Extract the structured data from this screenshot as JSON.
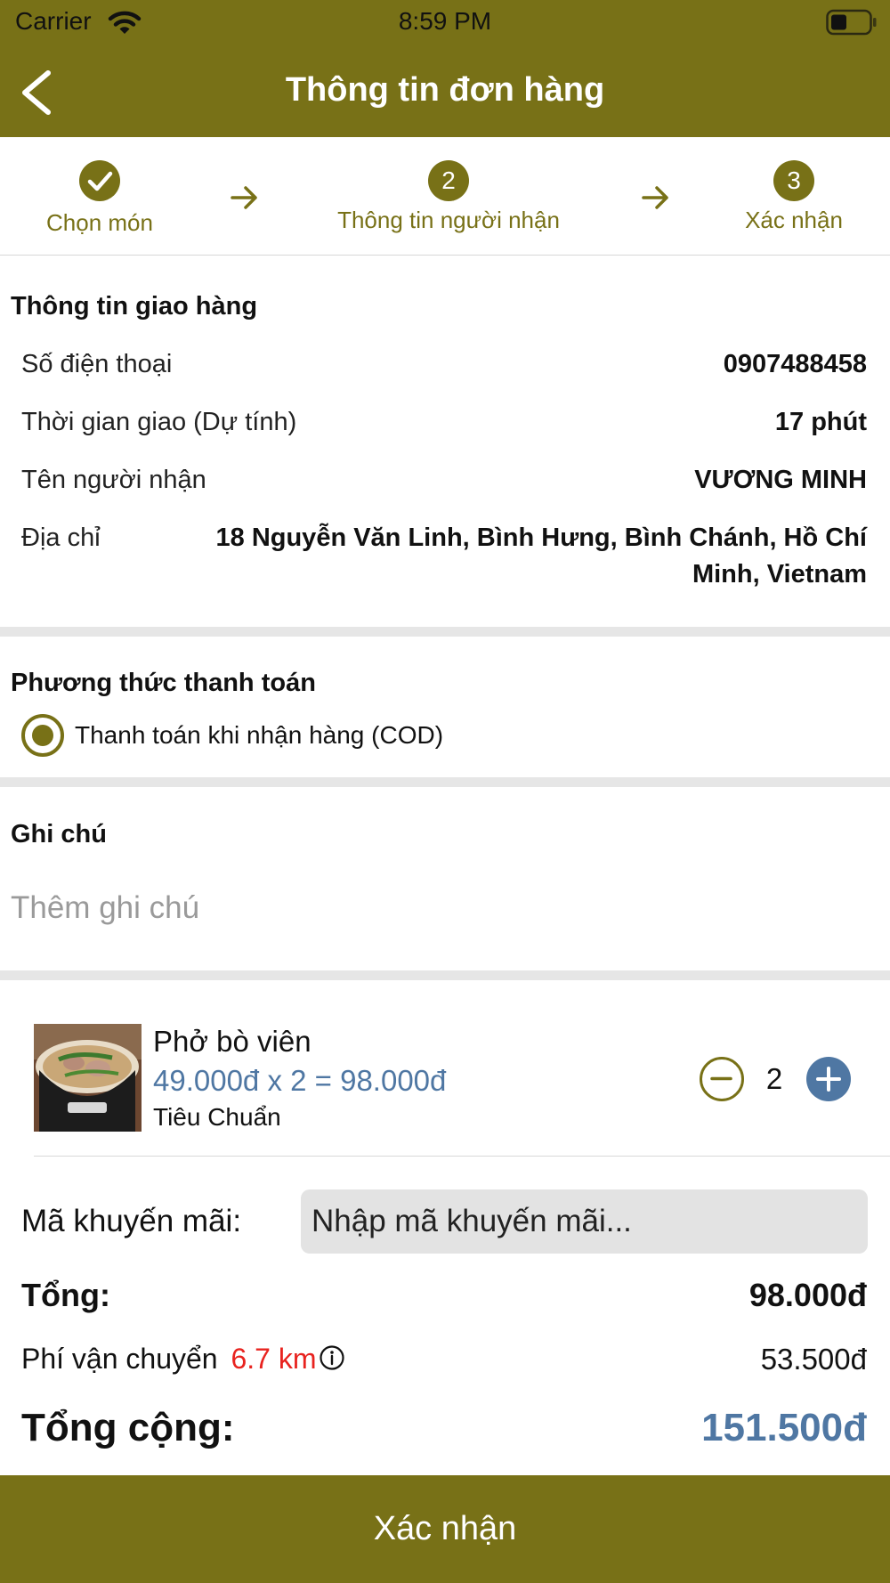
{
  "status_bar": {
    "carrier": "Carrier",
    "time": "8:59 PM"
  },
  "header": {
    "title": "Thông tin đơn hàng",
    "back_icon": "chevron-left-icon"
  },
  "steps": [
    {
      "label": "Chọn món",
      "marker": "✓",
      "done": true
    },
    {
      "label": "Thông tin người nhận",
      "marker": "2",
      "done": false
    },
    {
      "label": "Xác nhận",
      "marker": "3",
      "done": false
    }
  ],
  "delivery": {
    "title": "Thông tin giao hàng",
    "phone_label": "Số điện thoại",
    "phone_value": "0907488458",
    "time_label": "Thời gian giao (Dự tính)",
    "time_value": "17 phút",
    "recipient_label": "Tên người nhận",
    "recipient_value": "VƯƠNG MINH",
    "address_label": "Địa chỉ",
    "address_line1": "18 Nguyễn Văn Linh, Bình Hưng, Bình Chánh, Hồ Chí",
    "address_line2": "Minh, Vietnam"
  },
  "payment": {
    "title": "Phương thức thanh toán",
    "option_label": "Thanh toán khi nhận hàng (COD)",
    "selected": true
  },
  "note": {
    "title": "Ghi chú",
    "placeholder": "Thêm ghi chú",
    "value": ""
  },
  "cart_item": {
    "name": "Phở bò viên",
    "price_line": "49.000đ x 2 = 98.000đ",
    "variant": "Tiêu Chuẩn",
    "quantity": "2",
    "image_icon": "pho-bowl-image"
  },
  "promo": {
    "label": "Mã khuyến mãi:",
    "placeholder": "Nhập mã khuyến mãi...",
    "value": ""
  },
  "summary": {
    "subtotal_label": "Tổng:",
    "subtotal_value": "98.000đ",
    "shipping_label": "Phí vận chuyển",
    "shipping_distance": "6.7 km",
    "shipping_value": "53.500đ",
    "total_label": "Tổng cộng:",
    "total_value": "151.500đ"
  },
  "confirm_button": {
    "label": "Xác nhận"
  },
  "colors": {
    "brand": "#787117",
    "price_blue": "#4f77a3",
    "distance_red": "#e8231f",
    "section_gap": "#e6e6e6"
  }
}
